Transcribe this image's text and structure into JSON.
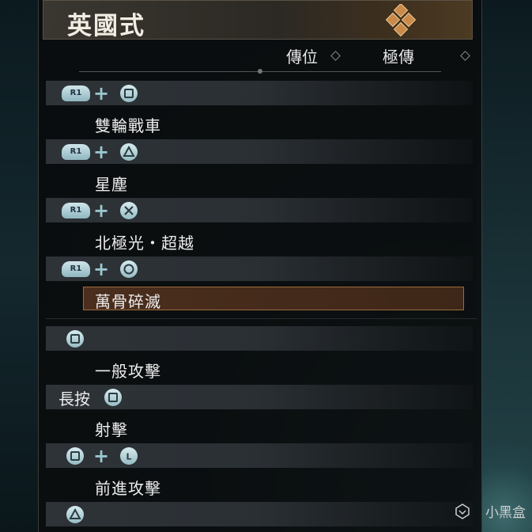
{
  "title": "英國式",
  "header": {
    "col1": "傳位",
    "col2": "極傳"
  },
  "colors": {
    "accent": "#9c6b3b",
    "button": "#a9cfd6"
  },
  "moves": [
    {
      "input": [
        "R1",
        "+",
        "square"
      ],
      "name": "雙輪戰車"
    },
    {
      "input": [
        "R1",
        "+",
        "triangle"
      ],
      "name": "星塵"
    },
    {
      "input": [
        "R1",
        "+",
        "cross"
      ],
      "name": "北極光・超越"
    },
    {
      "input": [
        "R1",
        "+",
        "circle"
      ],
      "name": "萬骨碎滅",
      "selected": true
    },
    {
      "input": [
        "square"
      ],
      "name": "一般攻擊"
    },
    {
      "input": [
        "hold",
        "square"
      ],
      "hold_label": "長按",
      "name": "射擊"
    },
    {
      "input": [
        "square",
        "+",
        "L"
      ],
      "name": "前進攻擊"
    },
    {
      "input": [
        "triangle"
      ],
      "name": ""
    }
  ],
  "labels": {
    "r1": "R1",
    "l": "L"
  },
  "watermark": "小黑盒"
}
